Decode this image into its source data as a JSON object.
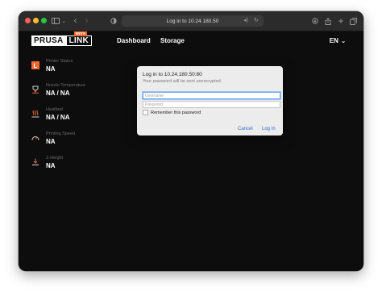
{
  "browser": {
    "address": "Log in to 10.24.180.50",
    "icons": [
      "sidebar-icon",
      "chevron-down-icon",
      "back-icon",
      "forward-icon",
      "privacy-shield-icon",
      "audio-icon",
      "reload-icon",
      "download-icon",
      "share-icon",
      "new-tab-icon",
      "tabs-overview-icon"
    ]
  },
  "header": {
    "logo_left": "PRUSA",
    "logo_right": "LINK",
    "logo_badge": "BETA",
    "nav": [
      "Dashboard",
      "Storage"
    ],
    "language": "EN"
  },
  "stats": [
    {
      "label": "Printer Status",
      "value": "NA",
      "icon": "printer-status-icon"
    },
    {
      "label": "Nozzle Temperature",
      "value": "NA / NA",
      "icon": "nozzle-icon"
    },
    {
      "label": "Heatbed",
      "value": "NA / NA",
      "icon": "heatbed-icon"
    },
    {
      "label": "Printing Speed",
      "value": "NA",
      "icon": "speedometer-icon"
    },
    {
      "label": "Z-Height",
      "value": "NA",
      "icon": "z-height-icon"
    }
  ],
  "dialog": {
    "title": "Log in to 10.24.180.50:80",
    "subtitle": "Your password will be sent unencrypted.",
    "username_placeholder": "Username",
    "password_placeholder": "Password",
    "remember_label": "Remember this password",
    "cancel_label": "Cancel",
    "login_label": "Log In"
  },
  "colors": {
    "page_background": "#0d0d0d",
    "accent_orange": "#fa6831",
    "dialog_link_blue": "#2b6fd6"
  }
}
